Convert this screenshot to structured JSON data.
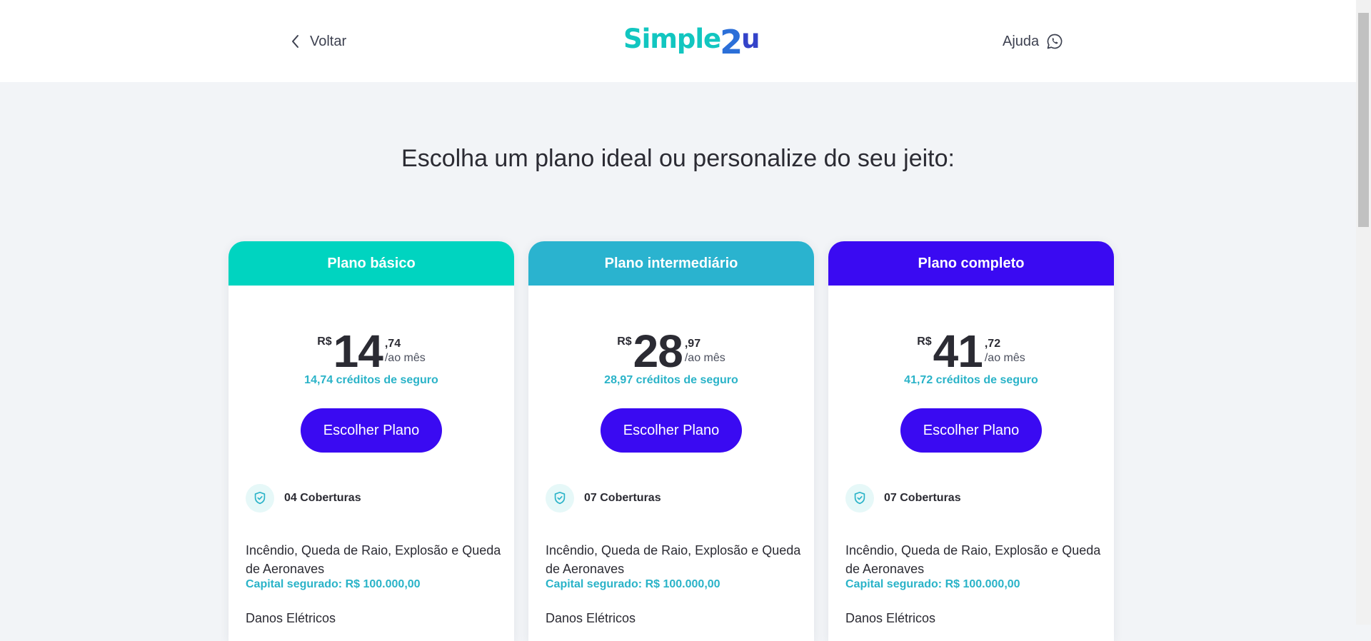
{
  "header": {
    "back_label": "Voltar",
    "logo": {
      "part1": "Simple",
      "part2": "2",
      "part3": "u"
    },
    "help_label": "Ajuda"
  },
  "headline": "Escolha um plano ideal ou personalize do seu jeito:",
  "colors": {
    "accent_button": "#3a0af2",
    "credits_text": "#2ab3c8",
    "plan_basic": "#00d4c0",
    "plan_intermediate": "#2ab3cf",
    "plan_complete": "#3a0af2"
  },
  "plans": [
    {
      "name": "Plano básico",
      "currency": "R$",
      "integer": "14",
      "cents": ",74",
      "period": "/ao mês",
      "credits": "14,74 créditos de seguro",
      "button": "Escolher Plano",
      "coverages_label": "04 Coberturas",
      "coverage_desc": "Incêndio, Queda de Raio, Explosão e Queda de Aeronaves",
      "coverage_capital": "Capital segurado: R$ 100.000,00",
      "next_coverage": "Danos Elétricos"
    },
    {
      "name": "Plano intermediário",
      "currency": "R$",
      "integer": "28",
      "cents": ",97",
      "period": "/ao mês",
      "credits": "28,97 créditos de seguro",
      "button": "Escolher Plano",
      "coverages_label": "07 Coberturas",
      "coverage_desc": "Incêndio, Queda de Raio, Explosão e Queda de Aeronaves",
      "coverage_capital": "Capital segurado: R$ 100.000,00",
      "next_coverage": "Danos Elétricos"
    },
    {
      "name": "Plano completo",
      "currency": "R$",
      "integer": "41",
      "cents": ",72",
      "period": "/ao mês",
      "credits": "41,72 créditos de seguro",
      "button": "Escolher Plano",
      "coverages_label": "07 Coberturas",
      "coverage_desc": "Incêndio, Queda de Raio, Explosão e Queda de Aeronaves",
      "coverage_capital": "Capital segurado: R$ 100.000,00",
      "next_coverage": "Danos Elétricos"
    }
  ]
}
